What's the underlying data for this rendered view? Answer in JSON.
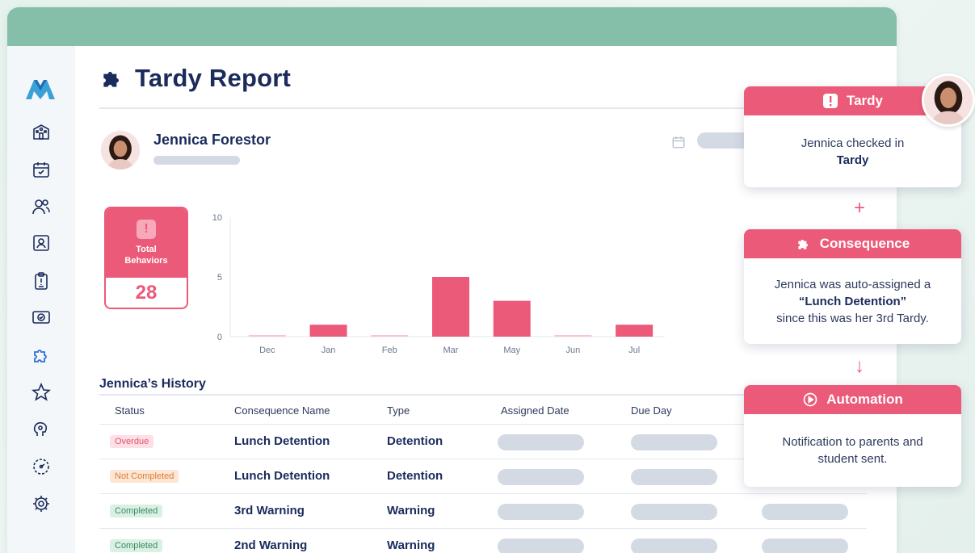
{
  "colors": {
    "brand_green": "#85bfaa",
    "accent_pink": "#ec5a79",
    "navy": "#1a2b5c",
    "placeholder": "#d4dae4"
  },
  "sidebar": {
    "items": [
      {
        "icon": "school-icon"
      },
      {
        "icon": "calendar-check-icon"
      },
      {
        "icon": "users-icon"
      },
      {
        "icon": "id-card-icon"
      },
      {
        "icon": "clipboard-icon"
      },
      {
        "icon": "ticket-icon"
      },
      {
        "icon": "puzzle-icon",
        "active": true
      },
      {
        "icon": "star-icon"
      },
      {
        "icon": "brain-icon"
      },
      {
        "icon": "dial-icon"
      },
      {
        "icon": "gear-icon"
      }
    ]
  },
  "page": {
    "title": "Tardy Report",
    "title_icon": "puzzle-icon"
  },
  "student": {
    "name": "Jennica Forestor"
  },
  "stat": {
    "label_line1": "Total",
    "label_line2": "Behaviors",
    "value": "28",
    "icon": "alert-icon"
  },
  "chart_data": {
    "type": "bar",
    "categories": [
      "Dec",
      "Jan",
      "Feb",
      "Mar",
      "May",
      "Jun",
      "Jul"
    ],
    "values": [
      0,
      1,
      0,
      5,
      3,
      0,
      1
    ],
    "ylim": [
      0,
      10
    ],
    "yticks": [
      0,
      5,
      10
    ],
    "color": "#ec5a79",
    "grid": false
  },
  "history": {
    "title": "Jennica’s History",
    "columns": [
      "Status",
      "Consequence Name",
      "Type",
      "Assigned Date",
      "Due Day"
    ],
    "rows": [
      {
        "status": "Overdue",
        "status_color": "red",
        "name": "Lunch Detention",
        "type": "Detention"
      },
      {
        "status": "Not Completed",
        "status_color": "orange",
        "name": "Lunch Detention",
        "type": "Detention"
      },
      {
        "status": "Completed",
        "status_color": "green",
        "name": "3rd Warning",
        "type": "Warning"
      },
      {
        "status": "Completed",
        "status_color": "green",
        "name": "2nd Warning",
        "type": "Warning"
      }
    ]
  },
  "panels": {
    "tardy": {
      "title": "Tardy",
      "icon": "alert-icon",
      "line1": "Jennica checked in",
      "line2": "Tardy"
    },
    "consequence": {
      "title": "Consequence",
      "icon": "puzzle-icon",
      "line1": "Jennica was auto-assigned a",
      "line2": "“Lunch Detention”",
      "line3": "since this was her 3rd Tardy."
    },
    "automation": {
      "title": "Automation",
      "icon": "automation-icon",
      "line1": "Notification to parents and",
      "line2": "student sent."
    },
    "connector_plus": "+",
    "connector_arrow": "↓"
  }
}
